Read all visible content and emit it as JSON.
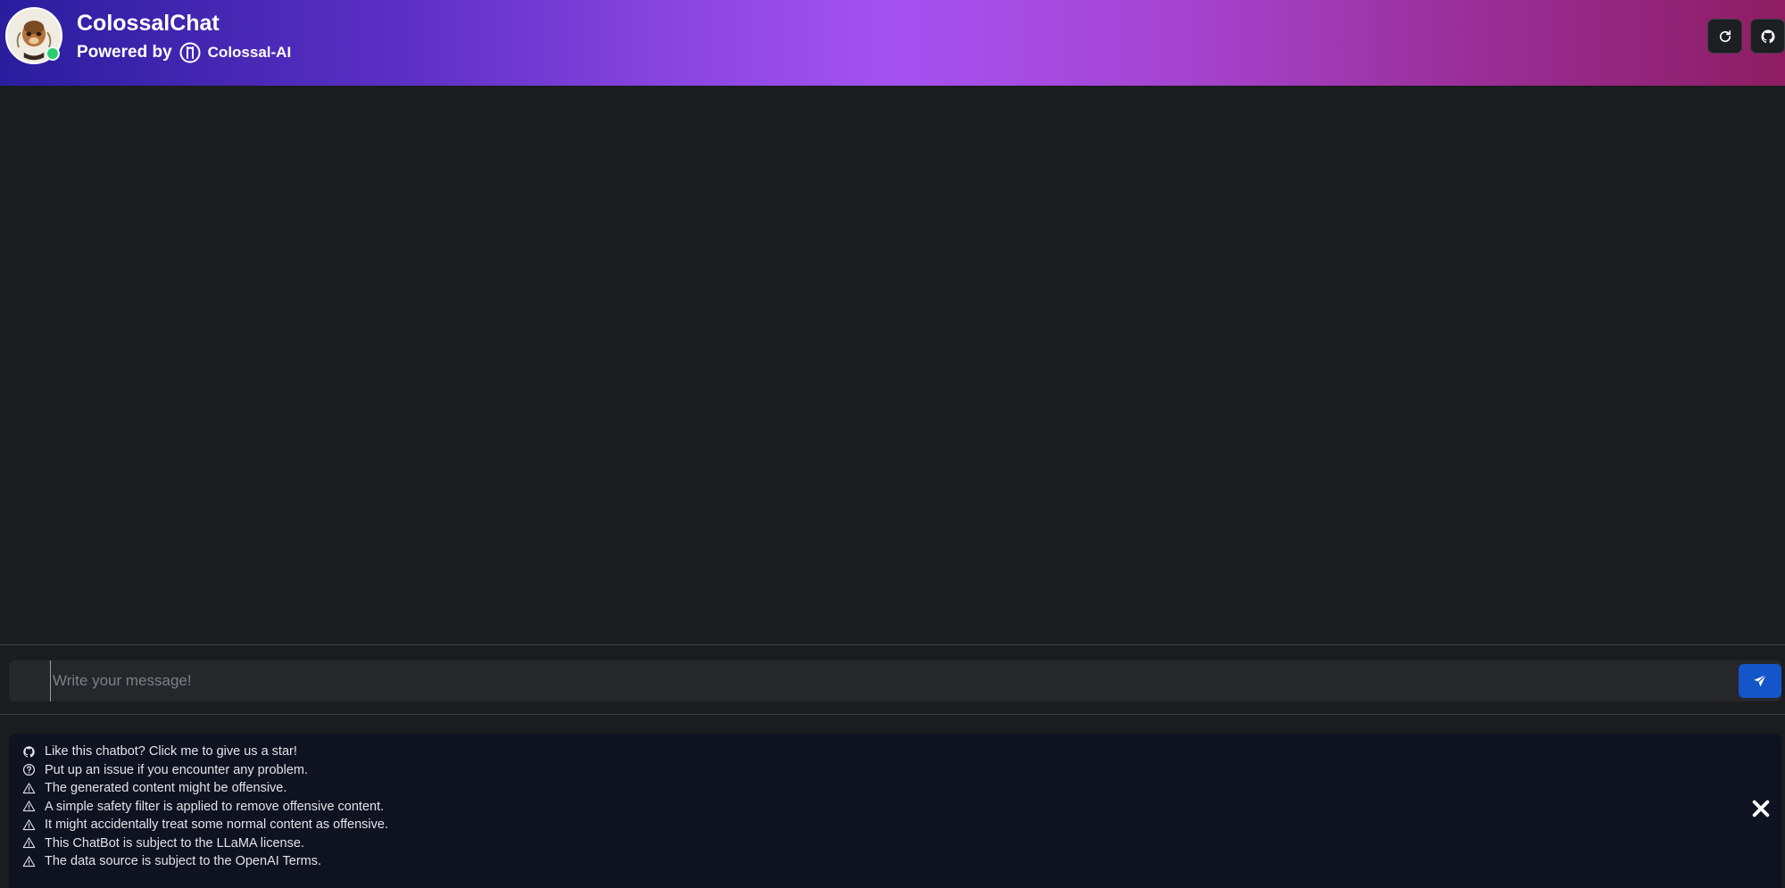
{
  "header": {
    "title": "ColossalChat",
    "powered_by": "Powered by",
    "brand": "Colossal-AI",
    "status": "online",
    "buttons": [
      {
        "name": "refresh-button",
        "icon": "refresh-icon"
      },
      {
        "name": "github-button",
        "icon": "github-icon"
      }
    ]
  },
  "composer": {
    "placeholder": "Write your message!",
    "value": "",
    "send_icon": "send-icon"
  },
  "notices": [
    {
      "icon": "github-icon",
      "text": "Like this chatbot? Click me to give us a star!"
    },
    {
      "icon": "question-circle-icon",
      "text": "Put up an issue if you encounter any problem."
    },
    {
      "icon": "warning-icon",
      "text": "The generated content might be offensive."
    },
    {
      "icon": "warning-icon",
      "text": "A simple safety filter is applied to remove offensive content."
    },
    {
      "icon": "warning-icon",
      "text": "It might accidentally treat some normal content as offensive."
    },
    {
      "icon": "warning-icon",
      "text": "This ChatBot is subject to the LLaMA license."
    },
    {
      "icon": "warning-icon",
      "text": "The data source is subject to the OpenAI Terms."
    }
  ],
  "colors": {
    "send_button": "#1456c9",
    "online_dot": "#2ecc71",
    "panel_bg": "#0f1220",
    "app_bg": "#1b1c1e"
  }
}
